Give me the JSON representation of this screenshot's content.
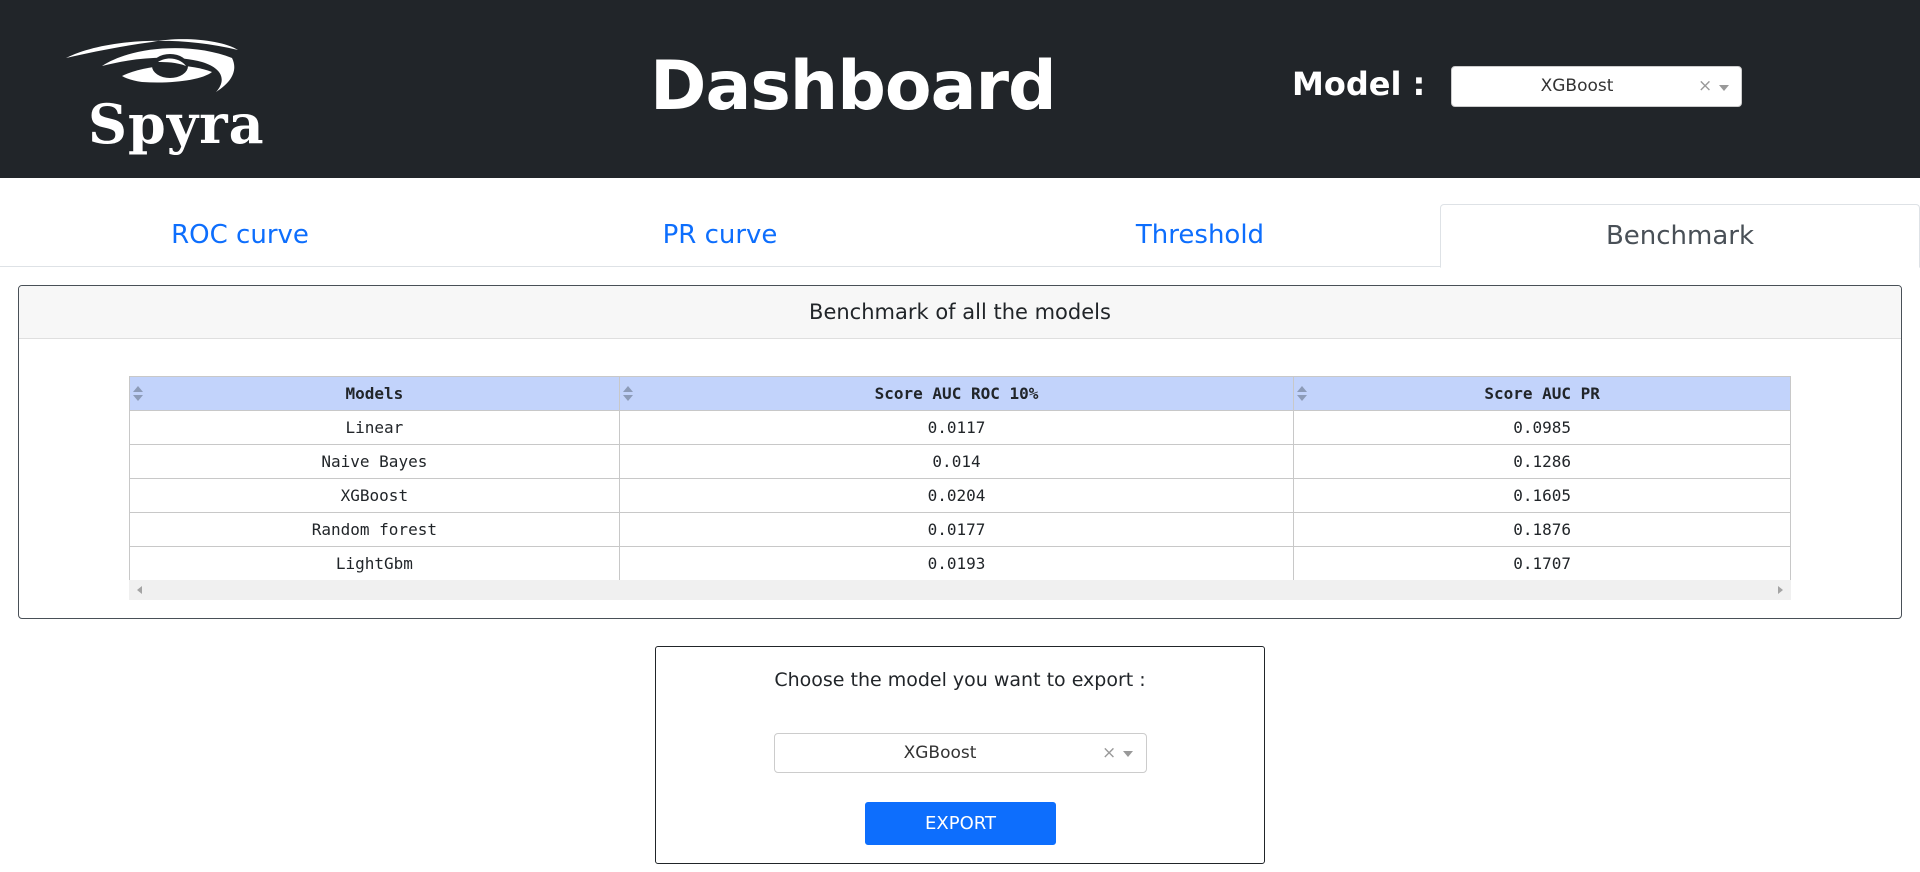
{
  "header": {
    "logo_text": "Spyra",
    "title": "Dashboard",
    "model_label": "Model :",
    "model_select": {
      "value": "XGBoost",
      "clear": "×"
    }
  },
  "tabs": [
    {
      "label": "ROC curve",
      "active": false
    },
    {
      "label": "PR curve",
      "active": false
    },
    {
      "label": "Threshold",
      "active": false
    },
    {
      "label": "Benchmark",
      "active": true
    }
  ],
  "benchmark": {
    "title": "Benchmark of all the models",
    "columns": [
      "Models",
      "Score AUC ROC 10%",
      "Score AUC PR"
    ],
    "rows": [
      [
        "Linear",
        "0.0117",
        "0.0985"
      ],
      [
        "Naive Bayes",
        "0.014",
        "0.1286"
      ],
      [
        "XGBoost",
        "0.0204",
        "0.1605"
      ],
      [
        "Random forest",
        "0.0177",
        "0.1876"
      ],
      [
        "LightGbm",
        "0.0193",
        "0.1707"
      ]
    ]
  },
  "export": {
    "label": "Choose the model you want to export :",
    "select": {
      "value": "XGBoost",
      "clear": "×"
    },
    "button_label": "EXPORT"
  },
  "colors": {
    "header_bg": "#212529",
    "link": "#0d6efd",
    "table_header_bg": "#c2d3fb",
    "button_bg": "#0d6efd"
  }
}
